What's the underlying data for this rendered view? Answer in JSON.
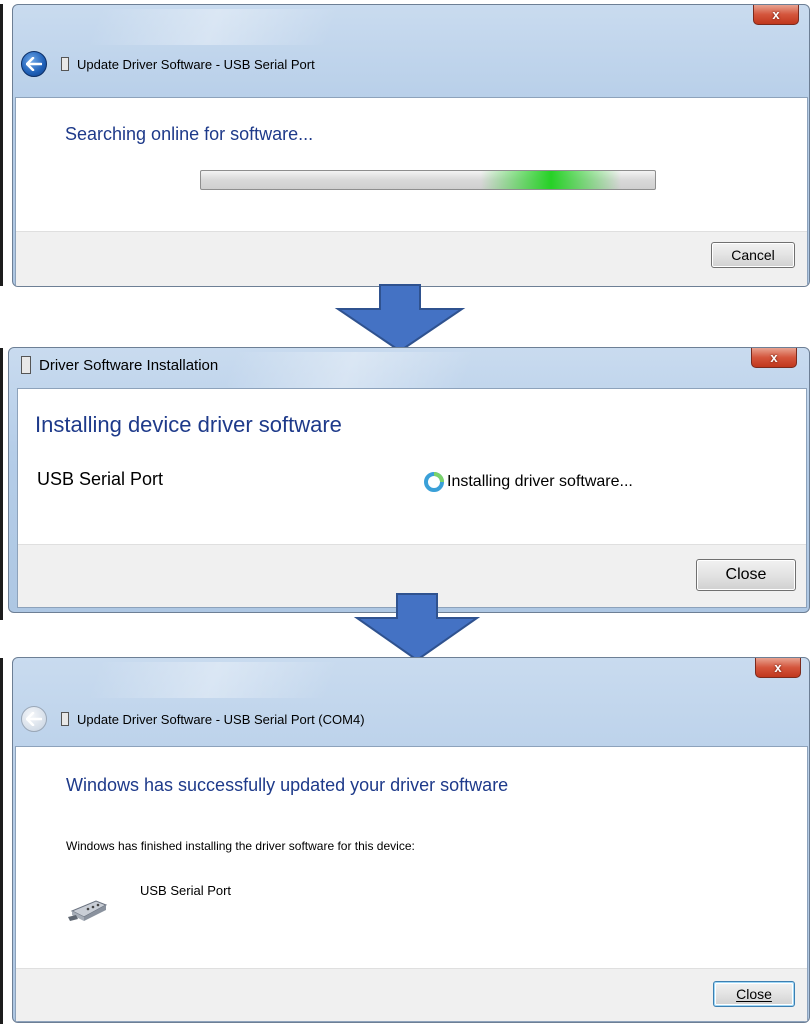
{
  "dialog1": {
    "title": "Update Driver Software - USB Serial Port",
    "heading": "Searching online for software...",
    "cancel_label": "Cancel",
    "close_glyph": "x"
  },
  "dialog2": {
    "title": "Driver Software Installation",
    "heading": "Installing device driver software",
    "device_name": "USB Serial Port",
    "status": "Installing driver software...",
    "close_label": "Close",
    "close_glyph": "x"
  },
  "dialog3": {
    "title": "Update Driver Software - USB Serial Port (COM4)",
    "heading": "Windows has successfully updated your driver software",
    "message": "Windows has finished installing the driver software for this device:",
    "device_name": "USB Serial Port",
    "close_label": "Close",
    "close_glyph": "x"
  },
  "icons": {
    "back": "back-arrow-icon",
    "device": "serial-port-icon",
    "spinner": "busy-spinner-icon",
    "flow_arrow": "down-arrow-icon"
  },
  "colors": {
    "heading_blue": "#1e3a8a",
    "flow_arrow": "#4472c4",
    "close_red": "#c0371d",
    "progress_green": "#26d126"
  }
}
